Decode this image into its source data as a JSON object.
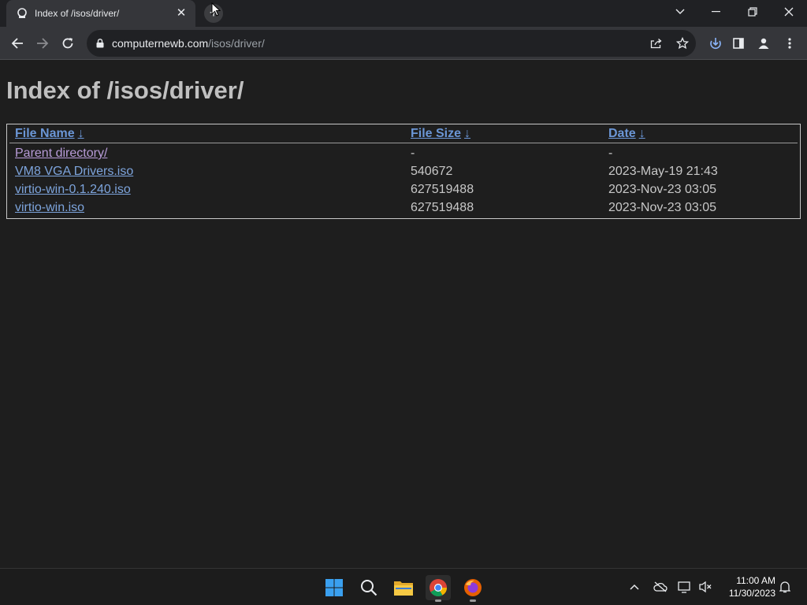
{
  "browser": {
    "tab_title": "Index of /isos/driver/",
    "new_tab_symbol": "+",
    "url_host": "computernewb.com",
    "url_path": "/isos/driver/"
  },
  "page": {
    "heading": "Index of /isos/driver/",
    "columns": [
      {
        "label": "File Name",
        "sort_arrow": "↓"
      },
      {
        "label": "File Size",
        "sort_arrow": "↓"
      },
      {
        "label": "Date",
        "sort_arrow": "↓"
      }
    ],
    "rows": [
      {
        "name": "Parent directory/",
        "size": "-",
        "date": "-"
      },
      {
        "name": "VM8 VGA Drivers.iso",
        "size": "540672",
        "date": "2023-May-19 21:43"
      },
      {
        "name": "virtio-win-0.1.240.iso",
        "size": "627519488",
        "date": "2023-Nov-23 03:05"
      },
      {
        "name": "virtio-win.iso",
        "size": "627519488",
        "date": "2023-Nov-23 03:05"
      }
    ]
  },
  "taskbar": {
    "time": "11:00 AM",
    "date": "11/30/2023",
    "apps": [
      "start-icon",
      "search-icon",
      "file-explorer-icon",
      "chrome-icon",
      "firefox-icon"
    ]
  },
  "colors": {
    "link": "#7da4dc",
    "visited_link": "#b89cd8",
    "heading": "#c0c0c0",
    "page_bg": "#1e1e1e"
  }
}
